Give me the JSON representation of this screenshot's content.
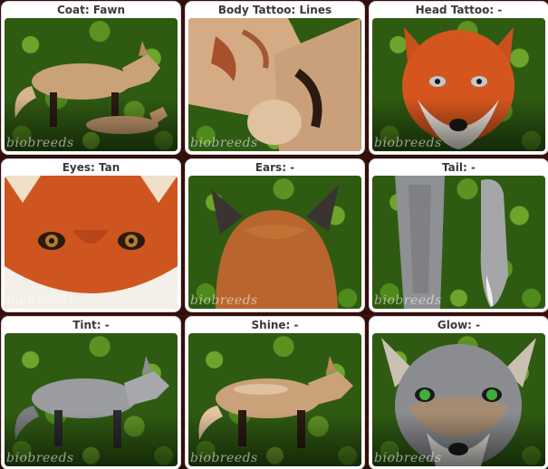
{
  "watermark": "biobreeds",
  "cards": [
    {
      "id": "coat",
      "label": "Coat: Fawn",
      "icon": "fox-standing"
    },
    {
      "id": "body-tattoo",
      "label": "Body Tattoo: Lines",
      "icon": "fox-body-closeup"
    },
    {
      "id": "head-tattoo",
      "label": "Head Tattoo: -",
      "icon": "fox-face"
    },
    {
      "id": "eyes",
      "label": "Eyes: Tan",
      "icon": "fox-eyes-closeup"
    },
    {
      "id": "ears",
      "label": "Ears: -",
      "icon": "fox-ears-back"
    },
    {
      "id": "tail",
      "label": "Tail: -",
      "icon": "fox-tails"
    },
    {
      "id": "tint",
      "label": "Tint: -",
      "icon": "grey-fox-standing"
    },
    {
      "id": "shine",
      "label": "Shine: -",
      "icon": "fox-standing-shine"
    },
    {
      "id": "glow",
      "label": "Glow: -",
      "icon": "grey-fox-face-glow"
    }
  ],
  "colors": {
    "fox_orange": "#c8501c",
    "fawn": "#caa27a",
    "grey_fur": "#9a9ca0",
    "leaf_green": "#5d9222",
    "eye_tan": "#b57a28",
    "eye_green": "#3fae3a"
  }
}
